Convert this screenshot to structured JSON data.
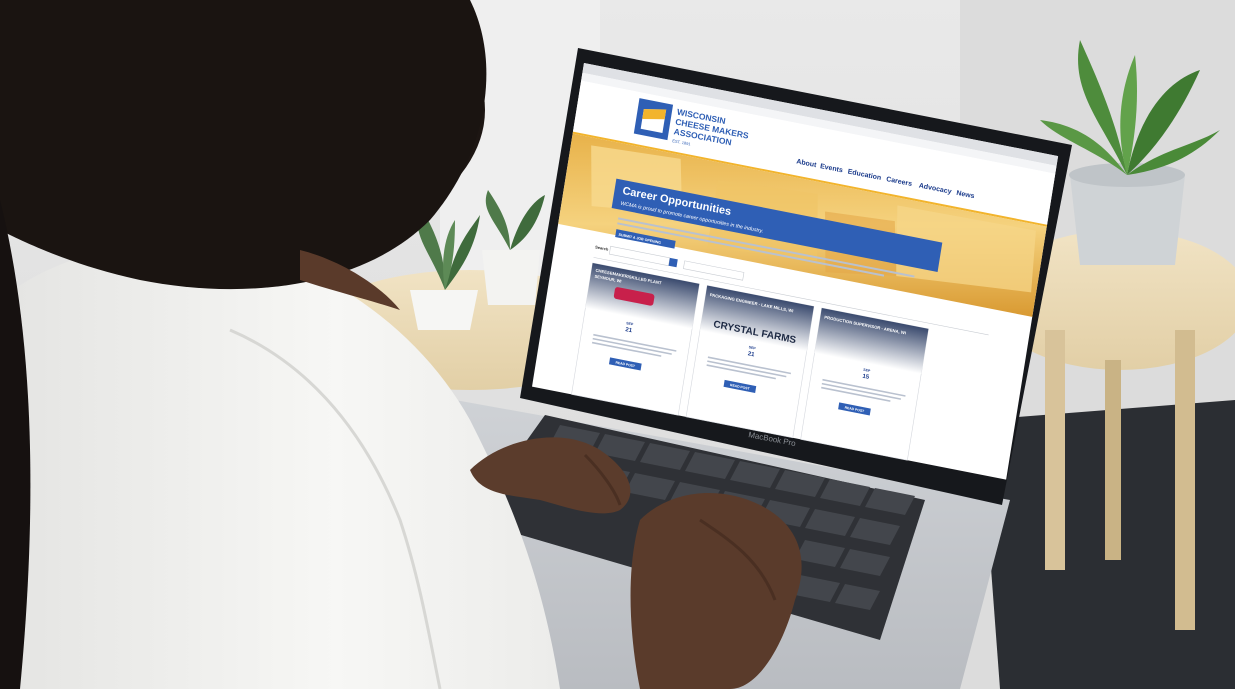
{
  "header": {
    "org_line1": "WISCONSIN",
    "org_line2": "CHEESE MAKERS",
    "org_line3": "ASSOCIATION",
    "est": "EST. 1891"
  },
  "nav": {
    "items": [
      {
        "label": "About"
      },
      {
        "label": "Events"
      },
      {
        "label": "Education"
      },
      {
        "label": "Careers"
      },
      {
        "label": "Advocacy"
      },
      {
        "label": "News"
      }
    ]
  },
  "hero": {
    "title": "Career Opportunities",
    "subtitle": "WCMA is proud to promote career opportunities in the industry."
  },
  "intro": {
    "submit_button": "SUBMIT A JOB OPENING"
  },
  "filters": {
    "search_label": "Search"
  },
  "jobs": [
    {
      "title": "CHEESEMAKER/SKILLED PLANT",
      "location": "SEYMOUR, WI",
      "month": "SEP",
      "day": "21",
      "button": "READ POST"
    },
    {
      "title": "PACKAGING ENGINEER - LAKE MILLS, WI",
      "location": "",
      "month": "SEP",
      "day": "21",
      "button": "READ POST"
    },
    {
      "title": "PRODUCTION SUPERVISOR - ARENA, WI",
      "location": "",
      "month": "SEP",
      "day": "15",
      "button": "READ POST"
    }
  ],
  "job_logos": {
    "crystal_farms": "CRYSTAL FARMS"
  },
  "laptop": {
    "brand": "MacBook Pro"
  },
  "colors": {
    "brand_blue": "#2f5fb5",
    "accent_gold": "#f2b42c",
    "nav_text": "#1c3c8c"
  }
}
